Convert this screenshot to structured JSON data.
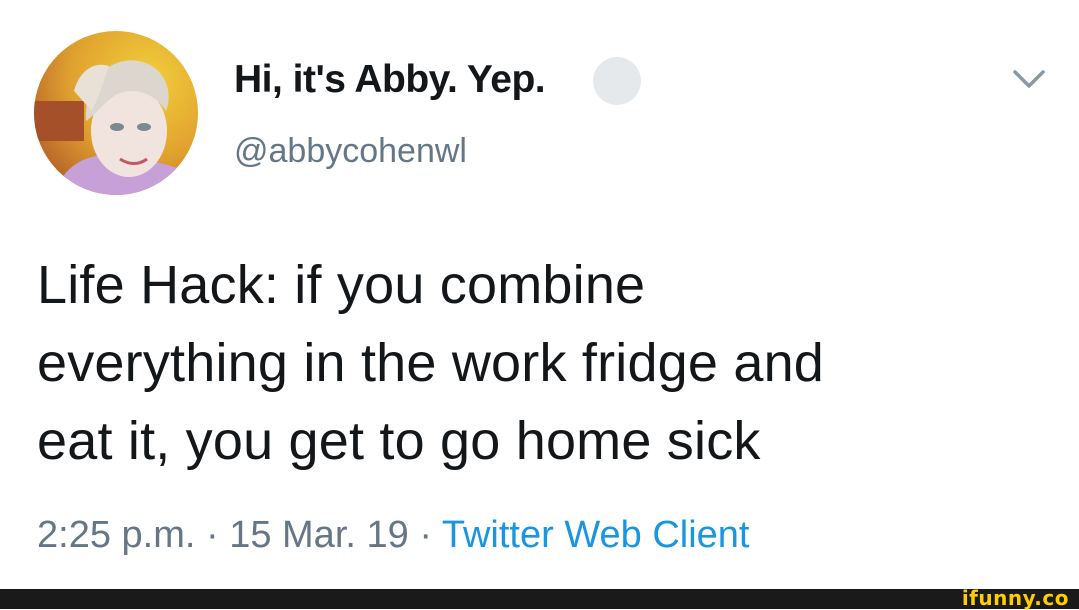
{
  "tweet": {
    "display_name": "Hi, it's Abby. Yep.",
    "handle": "@abbycohenwl",
    "text_lines": [
      "Life Hack: if you combine",
      "everything in the work fridge and",
      "eat it, you get to go home sick"
    ],
    "time": "2:25 p.m.",
    "separator": " · ",
    "date": "15 Mar. 19",
    "source": "Twitter Web Client"
  },
  "icons": {
    "menu": "chevron-down-icon",
    "avatar": "avatar"
  },
  "watermark": {
    "label": "ifunny.co"
  },
  "colors": {
    "text": "#14171a",
    "muted": "#657786",
    "link": "#1b95e0",
    "footer_bg": "#1a1a1a",
    "watermark": "#ffcc00"
  }
}
